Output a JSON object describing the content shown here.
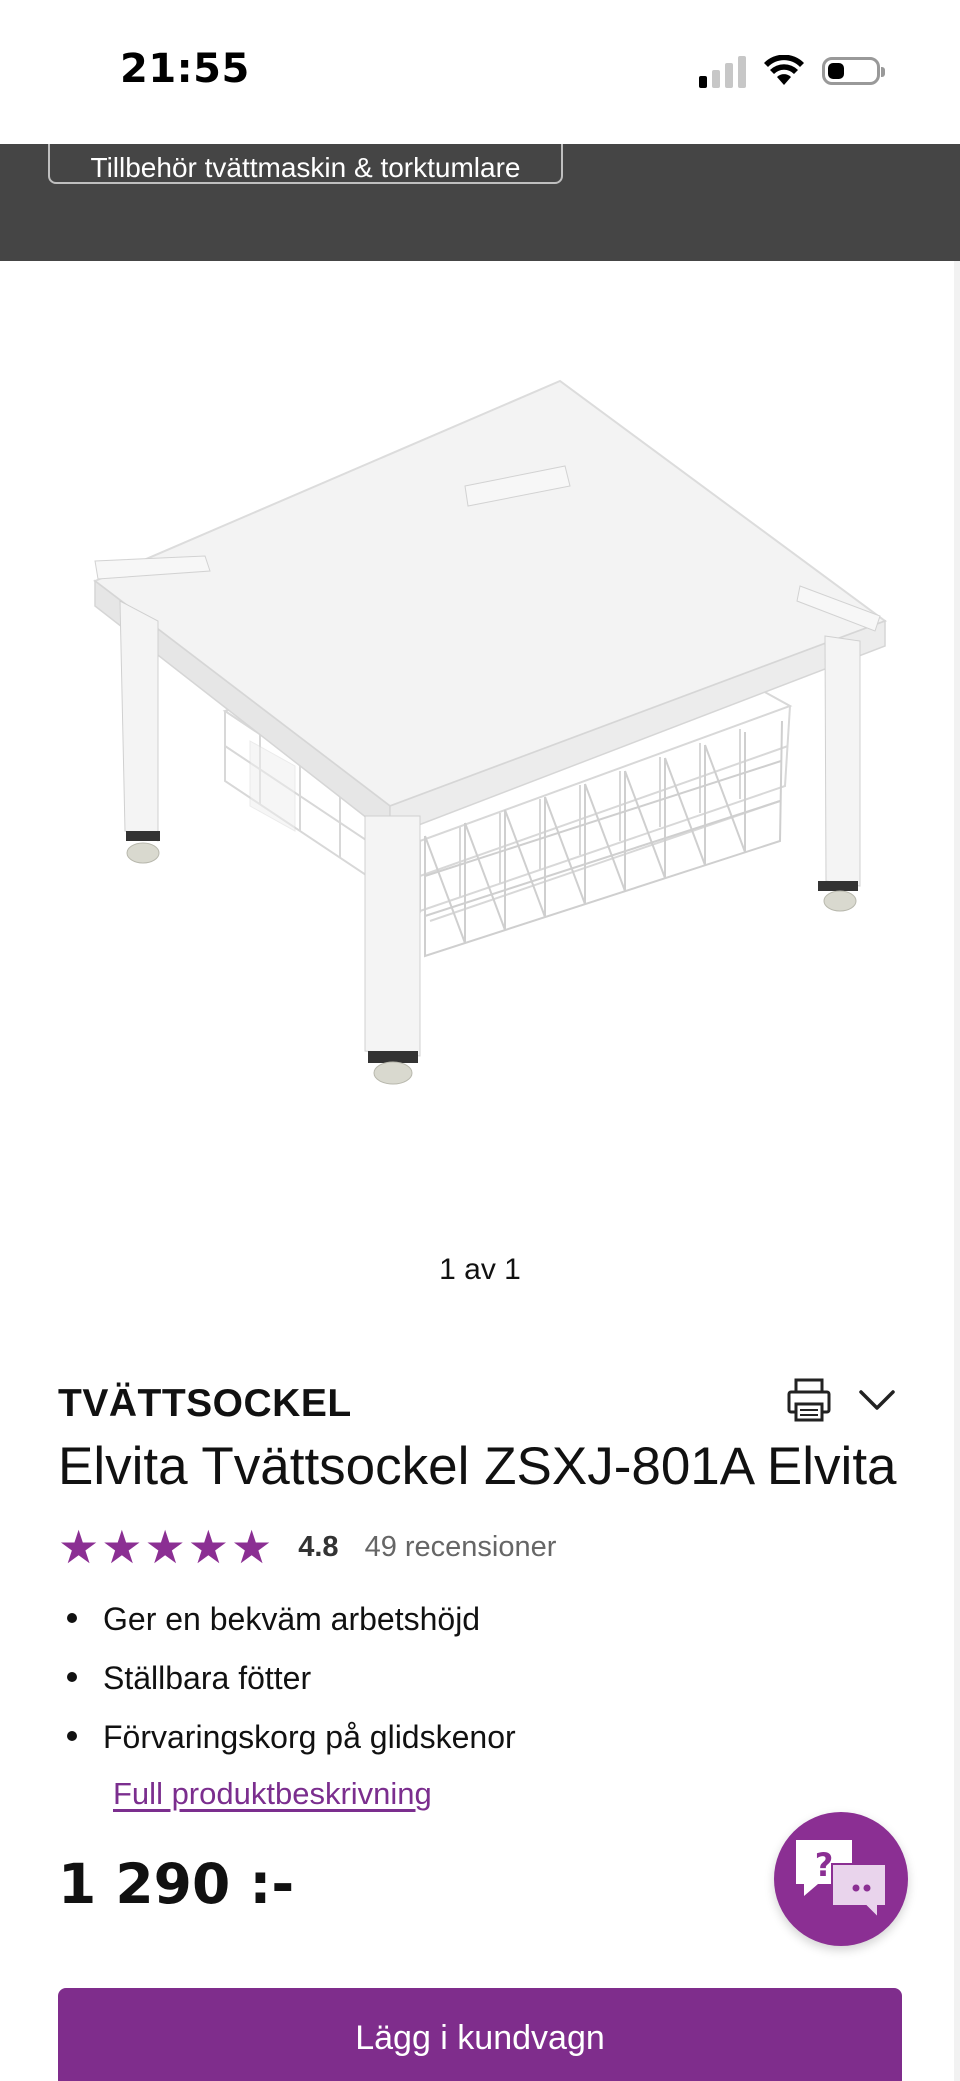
{
  "status_bar": {
    "time": "21:55",
    "icons": [
      "signal-icon",
      "wifi-icon",
      "battery-icon"
    ]
  },
  "header": {
    "category_chip": "Tillbehör tvättmaskin & torktumlare"
  },
  "gallery": {
    "caption": "1 av 1",
    "image": "washing-machine-pedestal-with-wire-basket"
  },
  "product": {
    "category": "TVÄTTSOCKEL",
    "title": "Elvita Tvättsockel ZSXJ-801A Elvita",
    "rating": {
      "stars": 5,
      "value": "4.8",
      "reviews": "49 recensioner"
    },
    "features": [
      "Ger en bekväm arbetshöjd",
      "Ställbara fötter",
      "Förvaringskorg på glidskenor"
    ],
    "full_description_link": "Full produktbeskrivning",
    "price": "1 290 :-",
    "add_to_cart": "Lägg i kundvagn"
  },
  "colors": {
    "accent": "#7f2d8c",
    "dark_band": "#454545"
  }
}
